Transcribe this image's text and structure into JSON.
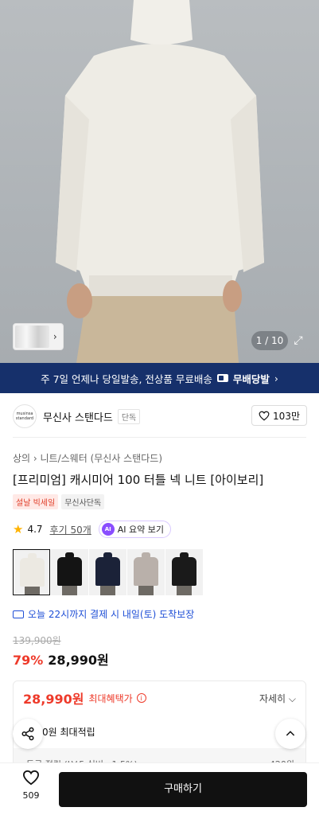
{
  "hero": {
    "image_counter": "1 / 10"
  },
  "banner": {
    "text": "주 7일 언제나 당일발송, 전상품 무료배송",
    "badge": "무배당발",
    "chevron": "›"
  },
  "brand": {
    "logo_line1": "musinsa",
    "logo_line2": "standard",
    "name": "무신사 스탠다드",
    "tag": "단독",
    "like_count": "103만"
  },
  "product": {
    "breadcrumb": "상의 › 니트/스웨터 (무신사 스탠다드)",
    "title": "[프리미엄] 캐시미어 100 터틀 넥 니트 [아이보리]",
    "tag_sale": "설날 빅세일",
    "tag_exclusive": "무신사단독",
    "rating": "4.7",
    "reviews": "후기 50개",
    "ai_badge": "AI",
    "ai_summary": "AI 요약 보기",
    "swatch_colors": [
      "#ece9e2",
      "#141414",
      "#1b2238",
      "#b9b0aa",
      "#1a1a1a"
    ],
    "delivery": "오늘 22시까지 결제 시 내일(토) 도착보장",
    "original_price": "139,900원",
    "discount": "79%",
    "price": "28,990원"
  },
  "benefit": {
    "max_price": "28,990원",
    "max_label": "최대혜택가",
    "info_icon": "i",
    "detail": "자세히 ⌵",
    "points": "0원 최대적립",
    "grade_label": "등급 적립 (LV.5 실버 · 1.5%)",
    "grade_value": "420원"
  },
  "bottom": {
    "like_count": "509",
    "buy_label": "구매하기"
  },
  "colors": {
    "banner_bg": "#16306b",
    "accent_red": "#ee3a2a",
    "delivery_blue": "#1f4fd6",
    "ai_purple": "#8a4dff"
  }
}
